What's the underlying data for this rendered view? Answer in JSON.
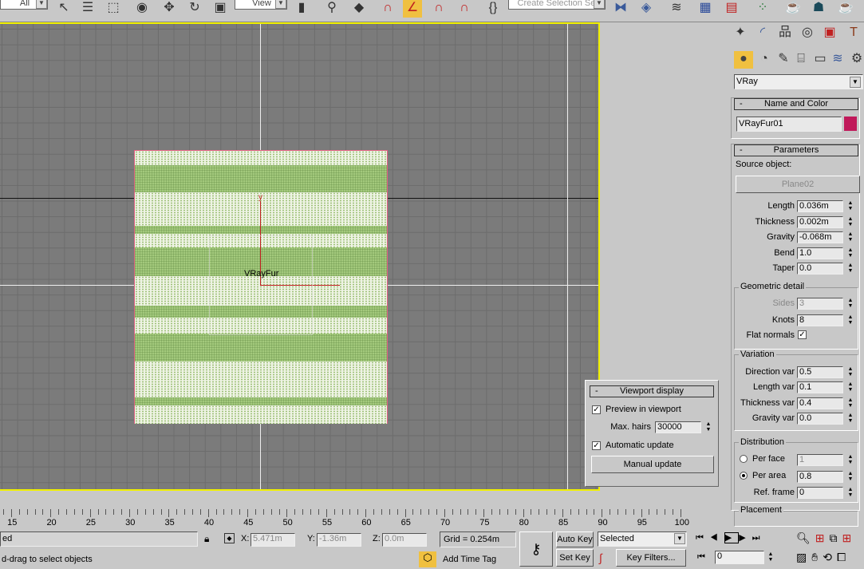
{
  "toolbar": {
    "selection_filter": "All",
    "reference_coord": "View",
    "named_selection": "Create Selection Set"
  },
  "command_panel": {
    "tabs": [
      "create",
      "modify",
      "hierarchy",
      "motion",
      "display",
      "utilities"
    ],
    "category": "VRay",
    "name_and_color": {
      "title": "Name and Color",
      "name": "VRayFur01",
      "color": "#c0195a"
    },
    "parameters": {
      "title": "Parameters",
      "source_label": "Source object:",
      "source": "Plane02",
      "fields": [
        {
          "label": "Length",
          "value": "0.036m"
        },
        {
          "label": "Thickness",
          "value": "0.002m"
        },
        {
          "label": "Gravity",
          "value": "-0.068m"
        },
        {
          "label": "Bend",
          "value": "1.0"
        },
        {
          "label": "Taper",
          "value": "0.0"
        }
      ],
      "geometric": {
        "title": "Geometric detail",
        "sides_label": "Sides",
        "sides": "3",
        "knots_label": "Knots",
        "knots": "8",
        "flat_label": "Flat normals",
        "flat": true
      },
      "variation": {
        "title": "Variation",
        "fields": [
          {
            "label": "Direction var",
            "value": "0.5"
          },
          {
            "label": "Length var",
            "value": "0.1"
          },
          {
            "label": "Thickness var",
            "value": "0.4"
          },
          {
            "label": "Gravity var",
            "value": "0.0"
          }
        ]
      },
      "distribution": {
        "title": "Distribution",
        "per_face_label": "Per face",
        "per_face": "1",
        "per_area_label": "Per area",
        "per_area": "0.8",
        "ref_label": "Ref. frame",
        "ref": "0",
        "selected": "per_area"
      },
      "placement": {
        "title": "Placement"
      }
    }
  },
  "viewport": {
    "object_label": "VRayFur",
    "axis_y": "y",
    "viewport_display": {
      "title": "Viewport display",
      "preview_label": "Preview in viewport",
      "preview": true,
      "max_label": "Max. hairs",
      "max": "30000",
      "auto_label": "Automatic update",
      "auto": true,
      "manual_label": "Manual update"
    }
  },
  "ruler": {
    "labels": [
      "15",
      "20",
      "25",
      "30",
      "35",
      "40",
      "45",
      "50",
      "55",
      "60",
      "65",
      "70",
      "75",
      "80",
      "85",
      "90",
      "95",
      "100"
    ]
  },
  "status": {
    "selection": "ed",
    "prompt": "d-drag to select objects",
    "x_label": "X:",
    "x": "5.471m",
    "y_label": "Y:",
    "y": "-1.36m",
    "z_label": "Z:",
    "z": "0.0m",
    "grid": "Grid = 0.254m",
    "add_time_tag": "Add Time Tag",
    "auto_key": "Auto Key",
    "set_key": "Set Key",
    "key_mode": "Selected",
    "key_filters": "Key Filters...",
    "frame": "0"
  }
}
